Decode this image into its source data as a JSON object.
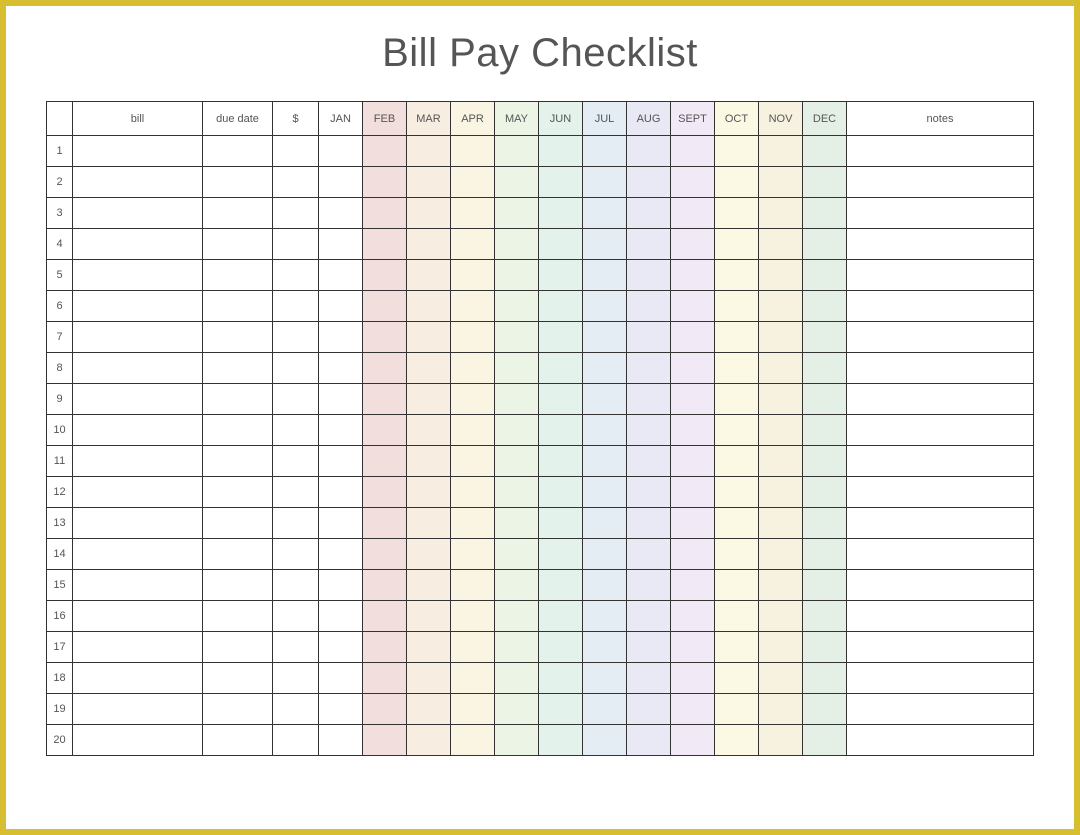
{
  "title": "Bill Pay Checklist",
  "columns": {
    "num": "",
    "bill": "bill",
    "due": "due date",
    "amount": "$",
    "months": [
      "JAN",
      "FEB",
      "MAR",
      "APR",
      "MAY",
      "JUN",
      "JUL",
      "AUG",
      "SEPT",
      "OCT",
      "NOV",
      "DEC"
    ],
    "notes": "notes"
  },
  "month_color_classes": [
    "",
    "c-feb",
    "c-mar",
    "c-apr",
    "c-may",
    "c-jun",
    "c-jul",
    "c-aug",
    "c-sept",
    "c-oct",
    "c-nov",
    "c-dec"
  ],
  "row_count": 20,
  "rows": [
    {
      "num": "1"
    },
    {
      "num": "2"
    },
    {
      "num": "3"
    },
    {
      "num": "4"
    },
    {
      "num": "5"
    },
    {
      "num": "6"
    },
    {
      "num": "7"
    },
    {
      "num": "8"
    },
    {
      "num": "9"
    },
    {
      "num": "10"
    },
    {
      "num": "11"
    },
    {
      "num": "12"
    },
    {
      "num": "13"
    },
    {
      "num": "14"
    },
    {
      "num": "15"
    },
    {
      "num": "16"
    },
    {
      "num": "17"
    },
    {
      "num": "18"
    },
    {
      "num": "19"
    },
    {
      "num": "20"
    }
  ]
}
